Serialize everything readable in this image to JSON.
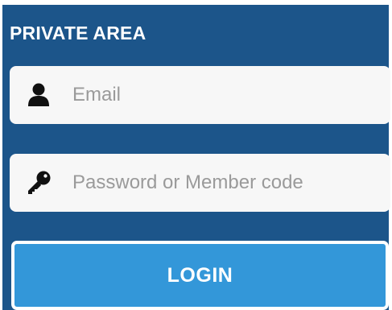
{
  "login_panel": {
    "title": "PRIVATE AREA",
    "email": {
      "icon": "user-icon",
      "placeholder": "Email",
      "value": ""
    },
    "password": {
      "icon": "key-icon",
      "placeholder": "Password or Member code",
      "value": ""
    },
    "login_label": "LOGIN"
  },
  "colors": {
    "panel_background": "#1c558a",
    "field_background": "#f7f7f7",
    "button_background": "#3397d9",
    "placeholder_text": "#9a9a9a",
    "title_text": "#ffffff"
  }
}
